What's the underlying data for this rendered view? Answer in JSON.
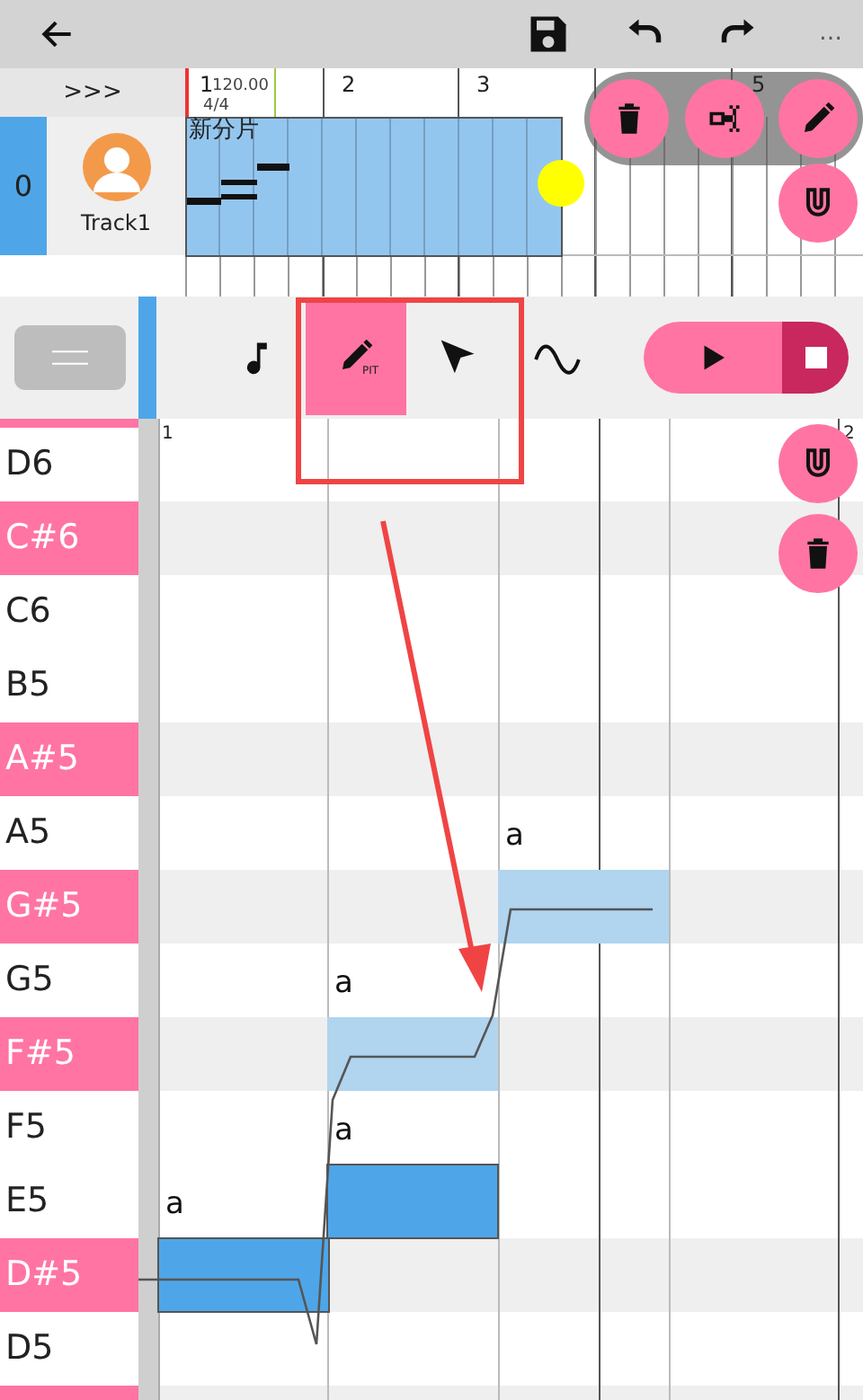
{
  "topbar": {
    "menu": "…"
  },
  "tracks": {
    "expand": ">>>",
    "ruler": {
      "bars": [
        "1",
        "2",
        "3",
        "5"
      ],
      "tempo": "120.00",
      "time_signature": "4/4"
    },
    "track": {
      "index": "0",
      "name": "Track1",
      "clip": "新分片"
    }
  },
  "tools": [
    {
      "kind": "note",
      "selected": false
    },
    {
      "kind": "pitch",
      "label": "PIT",
      "selected": true
    },
    {
      "kind": "select",
      "selected": false
    },
    {
      "kind": "vibrato",
      "selected": false
    }
  ],
  "roll": {
    "ruler": [
      "1",
      "2"
    ],
    "keys": [
      {
        "label": "D6",
        "kind": "white"
      },
      {
        "label": "C#6",
        "kind": "black"
      },
      {
        "label": "C6",
        "kind": "white"
      },
      {
        "label": "B5",
        "kind": "white"
      },
      {
        "label": "A#5",
        "kind": "black"
      },
      {
        "label": "A5",
        "kind": "white"
      },
      {
        "label": "G#5",
        "kind": "black"
      },
      {
        "label": "G5",
        "kind": "white"
      },
      {
        "label": "F#5",
        "kind": "black"
      },
      {
        "label": "F5",
        "kind": "white"
      },
      {
        "label": "E5",
        "kind": "white"
      },
      {
        "label": "D#5",
        "kind": "black"
      },
      {
        "label": "D5",
        "kind": "white"
      }
    ],
    "notes": [
      {
        "lyric": "a",
        "selected": true
      },
      {
        "lyric": "a",
        "selected": true
      },
      {
        "lyric": "a",
        "selected": false
      },
      {
        "lyric": "a",
        "selected": false
      }
    ]
  }
}
